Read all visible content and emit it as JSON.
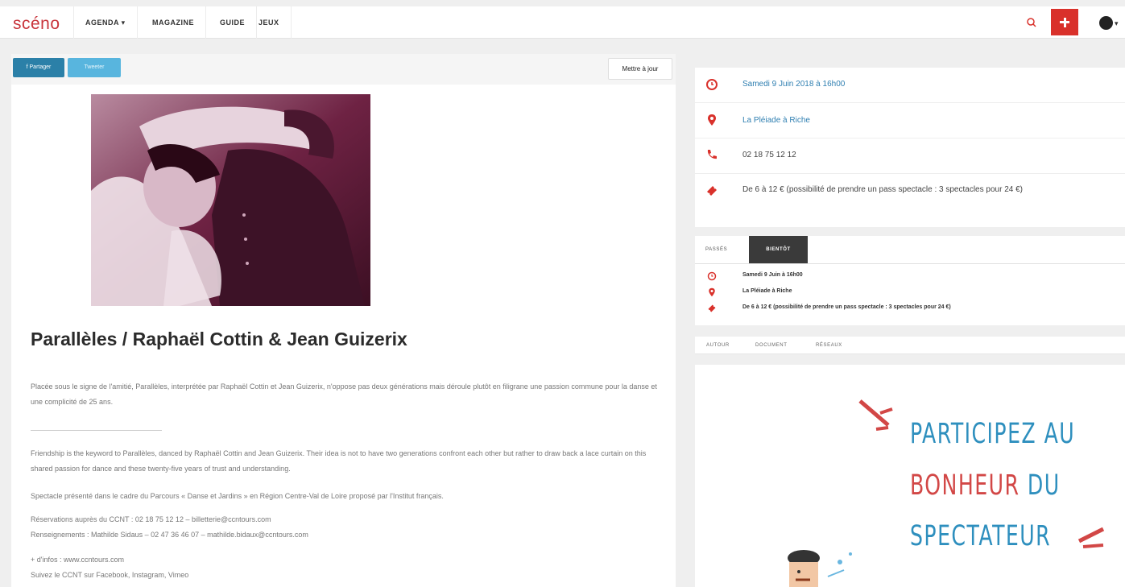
{
  "nav": {
    "logo": "scéno",
    "items": [
      {
        "label": "AGENDA ▾"
      },
      {
        "label": "MAGAZINE"
      },
      {
        "label": "GUIDE"
      },
      {
        "label": "JEUX"
      }
    ],
    "icons": {
      "search": "search-icon",
      "add": "plus-icon",
      "language": "globe-icon"
    },
    "accent_color": "#d9312b"
  },
  "toolbar": {
    "share_label": "f Partager",
    "tweet_label": "Tweeter",
    "update_label": "Mettre à jour"
  },
  "event": {
    "title": "Parallèles / Raphaël Cottin & Jean Guizerix",
    "paragraphs": [
      "Placée sous le signe de l'amitié, Parallèles, interprétée par Raphaël Cottin et Jean Guizerix, n'oppose pas deux générations mais déroule plutôt en filigrane une passion commune pour la danse et une complicité de 25 ans.",
      "Friendship is the keyword to Parallèles, danced by Raphaël Cottin and Jean Guizerix. Their idea is not to have two generations confront each other but rather to draw back a lace curtain on this shared passion for dance and these twenty-five years of trust and understanding.",
      "Spectacle présenté dans le cadre du Parcours « Danse et Jardins » en Région Centre-Val de Loire proposé par l'Institut français.",
      "Réservations auprès du CCNT : 02 18 75 12 12 – billetterie@ccntours.com",
      "Renseignements : Mathilde Sidaus – 02 47 36 46 07 – mathilde.bidaux@ccntours.com",
      "+ d'infos : www.ccntours.com",
      "Suivez le CCNT sur Facebook, Instagram, Vimeo"
    ]
  },
  "info": {
    "date": "Samedi 9 Juin 2018 à 16h00",
    "place": "La Pléiade à Riche",
    "phone": "02 18 75 12 12",
    "price": "De 6 à 12 € (possibilité de prendre un pass spectacle : 3 spectacles pour 24 €)",
    "icon_color": "#d9312b"
  },
  "tabs": {
    "past": "PASSÉS",
    "upcoming": "BIENTÔT"
  },
  "upcoming": {
    "date": "Samedi 9 Juin à 16h00",
    "place": "La Pléiade à Riche",
    "price": "De 6 à 12 € (possibilité de prendre un pass spectacle : 3 spectacles pour 24 €)"
  },
  "tabs2": {
    "a": "AUTOUR",
    "b": "DOCUMENT",
    "c": "RÉSEAUX"
  },
  "ad": {
    "line1": "PARTICIPEZ AU",
    "line2a": "BONHEUR",
    "line2b": "DU",
    "line3": "SPECTATEUR"
  }
}
